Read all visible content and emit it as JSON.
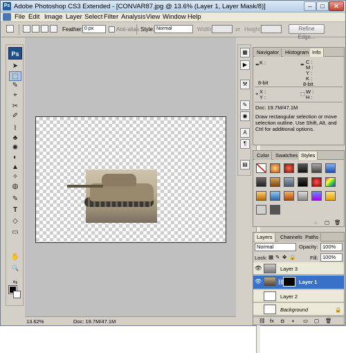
{
  "window": {
    "title": "Adobe Photoshop CS3 Extended - [CONVAR87.jpg @ 13.6% (Layer 1, Layer Mask/8)]",
    "logo": "Ps",
    "minimize": "–",
    "maximize": "□",
    "close": "✕"
  },
  "menu": [
    "File",
    "Edit",
    "Image",
    "Layer",
    "Select",
    "Filter",
    "Analysis",
    "View",
    "Window",
    "Help"
  ],
  "options": {
    "feather_label": "Feather:",
    "feather_value": "0 px",
    "antialias_label": "Anti-alias",
    "style_label": "Style:",
    "style_value": "Normal",
    "width_label": "Width:",
    "height_label": "Height:",
    "refine_edge": "Refine Edge..."
  },
  "toolbox": {
    "logo": "Ps",
    "tools": [
      "➤",
      "⬚",
      "✎",
      "⌖",
      "✂",
      "✐",
      "⌇",
      "♣",
      "✺",
      "◐",
      "▲",
      "✧",
      "◍",
      "✎",
      "T",
      "◇",
      "▭",
      "✋",
      "🔍"
    ]
  },
  "status": {
    "zoom": "13.62%",
    "doc": "Doc: 19.7M/47.1M"
  },
  "info_panel": {
    "tabs": [
      "Navigator",
      "Histogram",
      "Info"
    ],
    "k_label": "K :",
    "c_label": "C :",
    "m_label": "M :",
    "y_label": "Y :",
    "k2_label": "K :",
    "bit1": "8-bit",
    "bit2": "8-bit",
    "x_label": "X :",
    "y_coord_label": "Y :",
    "w_label": "W :",
    "h_label": "H :",
    "doc": "Doc: 19.7M/47.1M",
    "hint": "Draw rectangular selection or move selection outline. Use Shift, Alt, and Ctrl for additional options."
  },
  "styles_panel": {
    "tabs": [
      "Color",
      "Swatches",
      "Styles"
    ]
  },
  "layers_panel": {
    "tabs": [
      "Layers",
      "Channels",
      "Paths"
    ],
    "blend_mode": "Normal",
    "opacity_label": "Opacity:",
    "opacity_value": "100%",
    "lock_label": "Lock:",
    "fill_label": "Fill:",
    "fill_value": "100%",
    "layers": [
      {
        "name": "Layer 3",
        "selected": false
      },
      {
        "name": "Layer 1",
        "selected": true
      },
      {
        "name": "Layer 2",
        "selected": false
      },
      {
        "name": "Background",
        "selected": false
      }
    ]
  },
  "colors": {
    "selection": "#3a71c8",
    "titlebar": "#b9d1ea"
  }
}
